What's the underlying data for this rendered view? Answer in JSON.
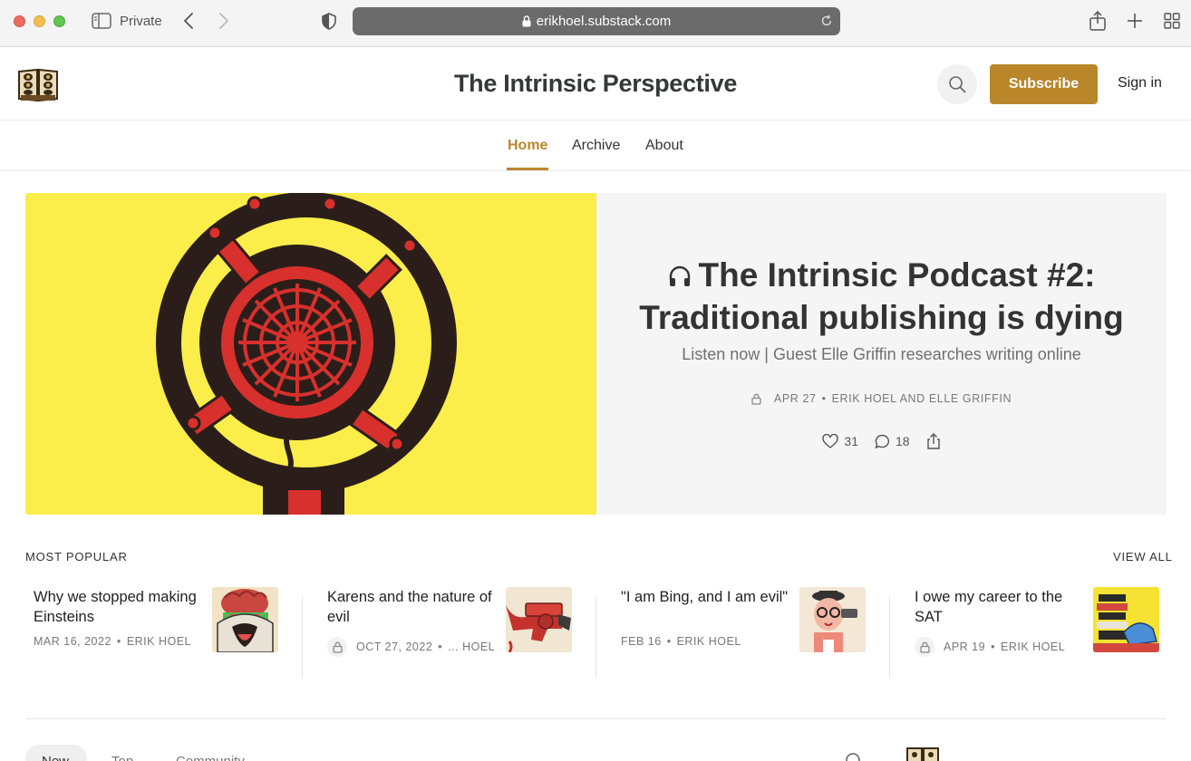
{
  "browser": {
    "mode_label": "Private",
    "url": "erikhoel.substack.com"
  },
  "header": {
    "site_title": "The Intrinsic Perspective",
    "subscribe_label": "Subscribe",
    "signin_label": "Sign in"
  },
  "nav": {
    "tabs": [
      {
        "label": "Home",
        "active": true
      },
      {
        "label": "Archive",
        "active": false
      },
      {
        "label": "About",
        "active": false
      }
    ]
  },
  "hero": {
    "title": "The Intrinsic Podcast #2: Traditional publishing is dying",
    "subtitle": "Listen now | Guest Elle Griffin researches writing online",
    "date": "APR 27",
    "authors": "ERIK HOEL AND ELLE GRIFFIN",
    "likes": "31",
    "comments": "18",
    "image_bg": "#fbed4a"
  },
  "most_popular": {
    "heading": "MOST POPULAR",
    "view_all": "VIEW ALL",
    "posts": [
      {
        "title": "Why we stopped making Einsteins",
        "date": "MAR 16, 2022",
        "author": "ERIK HOEL",
        "locked": false
      },
      {
        "title": "Karens and the nature of evil",
        "date": "OCT 27, 2022",
        "author": "... HOEL",
        "locked": true
      },
      {
        "title": "\"I am Bing, and I am evil\"",
        "date": "FEB 16",
        "author": "ERIK HOEL",
        "locked": false
      },
      {
        "title": "I owe my career to the SAT",
        "date": "APR 19",
        "author": "ERIK HOEL",
        "locked": true
      }
    ]
  },
  "feed_tabs": [
    "New",
    "Top",
    "Community"
  ],
  "colors": {
    "accent": "#b9872a",
    "hero_yellow": "#fbed4a",
    "hero_red": "#d8302c",
    "hero_dark": "#2b1e1a"
  }
}
